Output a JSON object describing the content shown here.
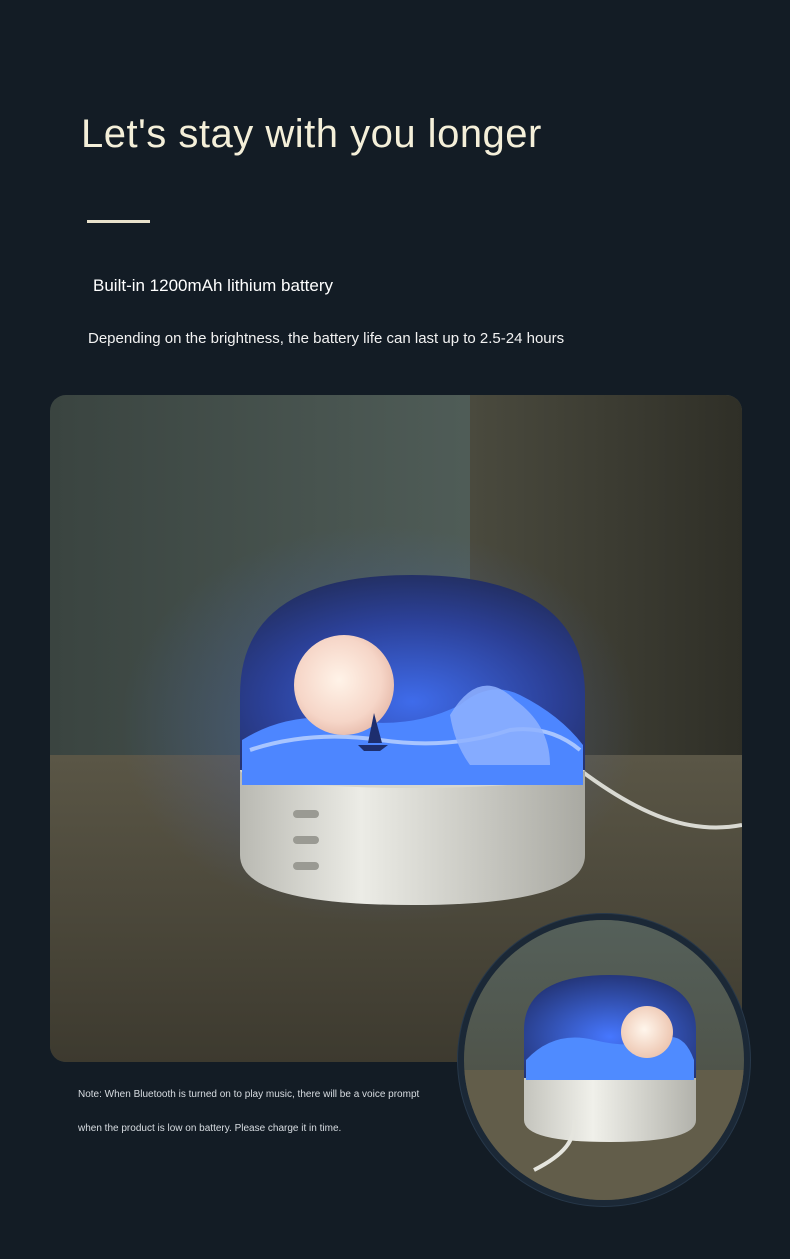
{
  "headline": "Let's stay with you longer",
  "subtitle": "Built-in 1200mAh lithium battery",
  "description": "Depending on the brightness, the battery life can last up to 2.5-24 hours",
  "note": {
    "line1": "Note: When Bluetooth is turned on to play music, there will be a voice prompt",
    "line2": "when the product is low on battery. Please charge it in time."
  },
  "colors": {
    "background": "#131c25",
    "headline": "#f4efd9",
    "accent_blue": "#2e5bd6"
  },
  "images": {
    "main": "night-light-lamp-photo",
    "inset": "lamp-closeup-photo"
  }
}
